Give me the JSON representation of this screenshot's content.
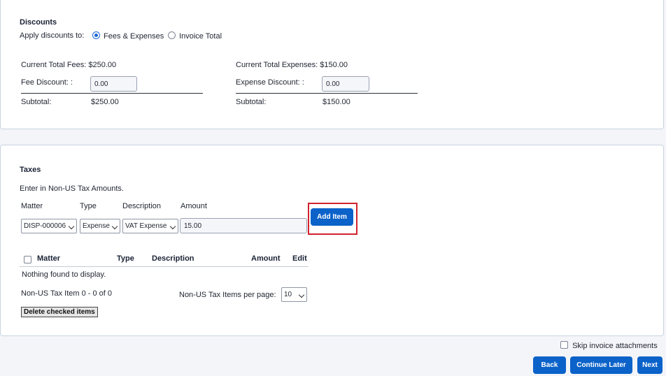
{
  "discounts": {
    "title": "Discounts",
    "apply_label": "Apply discounts to:",
    "options": [
      {
        "label": "Fees & Expenses",
        "selected": true
      },
      {
        "label": "Invoice Total",
        "selected": false
      }
    ],
    "fees": {
      "current_total_label": "Current Total Fees: $250.00",
      "discount_label": "Fee Discount: :",
      "discount_value": "0.00",
      "subtotal_label": "Subtotal:",
      "subtotal_value": "$250.00"
    },
    "expenses": {
      "current_total_label": "Current Total Expenses: $150.00",
      "discount_label": "Expense Discount: :",
      "discount_value": "0.00",
      "subtotal_label": "Subtotal:",
      "subtotal_value": "$150.00"
    }
  },
  "taxes": {
    "title": "Taxes",
    "instruction": "Enter in Non-US Tax Amounts.",
    "form_headers": {
      "matter": "Matter",
      "type": "Type",
      "description": "Description",
      "amount": "Amount"
    },
    "form_values": {
      "matter": "DISP-000006",
      "type": "Expense",
      "description": "VAT Expense",
      "amount": "15.00"
    },
    "add_item_label": "Add Item",
    "table_headers": {
      "matter": "Matter",
      "type": "Type",
      "description": "Description",
      "amount": "Amount",
      "edit": "Edit"
    },
    "empty_message": "Nothing found to display.",
    "pagination_label": "Non-US Tax Item 0 - 0 of 0",
    "per_page_label": "Non-US Tax Items per page:",
    "per_page_value": "10",
    "delete_label": "Delete checked items"
  },
  "footer": {
    "skip_label": "Skip invoice attachments",
    "back_label": "Back",
    "continue_label": "Continue Later",
    "next_label": "Next"
  },
  "colors": {
    "primary": "#0b62c9",
    "highlight": "#d0222e"
  }
}
